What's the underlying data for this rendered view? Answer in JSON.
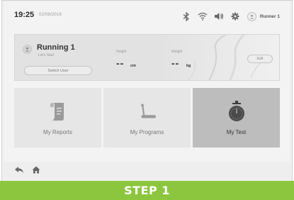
{
  "status_bar": {
    "time": "19:25",
    "date": "02/08/2016",
    "icons": [
      "bluetooth-icon",
      "wifi-icon",
      "volume-icon",
      "settings-gear-icon"
    ],
    "user_name": "Runner 1"
  },
  "profile": {
    "name": "Running 1",
    "subtitle": "Let's Start",
    "switch_user_label": "Switch User",
    "height_label": "Height",
    "height_value": "--",
    "height_unit": "cm",
    "weight_label": "Weight",
    "weight_value": "--",
    "weight_unit": "kg",
    "edit_label": "Edit"
  },
  "tiles": [
    {
      "label": "My Reports",
      "icon": "report-icon",
      "active": false
    },
    {
      "label": "My Programs",
      "icon": "treadmill-icon",
      "active": false
    },
    {
      "label": "My Test",
      "icon": "stopwatch-icon",
      "active": true
    }
  ],
  "bottom_nav": {
    "icons": [
      "back-icon",
      "home-icon"
    ]
  },
  "banner": {
    "text": "STEP 1",
    "color": "#8cc63f"
  }
}
